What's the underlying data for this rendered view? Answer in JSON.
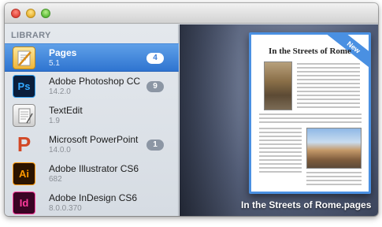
{
  "sidebar": {
    "section_title": "LIBRARY",
    "apps": [
      {
        "name": "Pages",
        "version": "5.1",
        "badge": "4",
        "icon": "pages-icon"
      },
      {
        "name": "Adobe Photoshop CC",
        "version": "14.2.0",
        "badge": "9",
        "icon": "photoshop-icon",
        "icon_text": "Ps"
      },
      {
        "name": "TextEdit",
        "version": "1.9",
        "badge": "",
        "icon": "textedit-icon"
      },
      {
        "name": "Microsoft PowerPoint",
        "version": "14.0.0",
        "badge": "1",
        "icon": "powerpoint-icon",
        "icon_text": "P"
      },
      {
        "name": "Adobe Illustrator CS6",
        "version": "682",
        "badge": "",
        "icon": "illustrator-icon",
        "icon_text": "Ai"
      },
      {
        "name": "Adobe InDesign CS6",
        "version": "8.0.0.370",
        "badge": "",
        "icon": "indesign-icon",
        "icon_text": "Id"
      }
    ]
  },
  "preview": {
    "doc_title": "In the Streets of Rome",
    "ribbon": "New",
    "caption": "In the Streets of Rome.pages"
  },
  "colors": {
    "selection": "#2f74d0",
    "accent": "#4a90e2",
    "badge": "#8c96a4"
  }
}
